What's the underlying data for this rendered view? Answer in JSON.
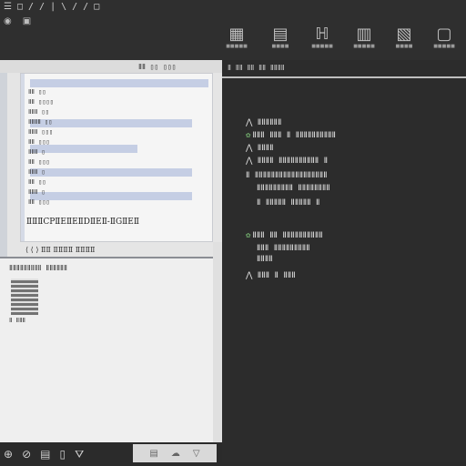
{
  "menu": [
    "☰",
    "□",
    "/",
    "/",
    "|",
    "\\",
    "/",
    "/",
    "□"
  ],
  "toolbar": {
    "left_icons": [
      "◉",
      "▣"
    ],
    "tools": [
      {
        "name": "tool-a",
        "glyph": "▦",
        "label": "■■■■■"
      },
      {
        "name": "tool-b",
        "glyph": "▤",
        "label": "■■■■"
      },
      {
        "name": "tool-c",
        "glyph": "ℍ",
        "label": "■■■■■"
      },
      {
        "name": "tool-d",
        "glyph": "▥",
        "label": "■■■■■"
      },
      {
        "name": "tool-e",
        "glyph": "▧",
        "label": "■■■■"
      },
      {
        "name": "tool-f",
        "glyph": "▢",
        "label": "■■■■■"
      }
    ]
  },
  "left": {
    "header": "ⅡⅡ ▯▯ ▯▯▯",
    "doc_lines": [
      "ⅡⅡ ▯▯",
      "ⅡⅡ ▯▯▯▯",
      "ⅡⅡⅡ ▯▯",
      "ⅡⅡⅡⅡ ▯▯",
      "ⅡⅡⅡ ▯▯▯",
      "ⅡⅡ ▯▯▯",
      "ⅡⅡⅡ ▯",
      "ⅡⅡ ▯▯▯",
      "ⅡⅡⅡ ▯",
      "ⅡⅡ ▯▯",
      "ⅡⅡⅡ ▯",
      "ⅡⅡ ▯▯▯"
    ],
    "doc_caption": "ⅡⅡⅡCPⅡEⅡEⅡDⅡEⅡ-ⅡGⅡEⅡ",
    "below_caption": "⟨ ⟨ ⟩ ⅡⅡ ⅡⅡⅡⅡ ⅡⅡⅡⅡ",
    "lower_title": "ⅡⅡⅡⅡⅡⅡⅡⅡⅡ ⅡⅡⅡⅡⅡⅡ",
    "qr_caption": "Ⅱ ⅡⅡⅡ"
  },
  "right": {
    "tab": "Ⅱ ⅡⅡ ⅡⅡ ⅡⅡ ⅡⅡⅡⅡ",
    "lines": [
      "⋀ ⅡⅡⅡⅡⅡⅡ",
      "ⅡⅡⅡ  ⅡⅡⅡ  Ⅱ  ⅡⅡⅡⅡⅡⅡⅡⅡⅡⅡ",
      "⋀ ⅡⅡⅡⅡ",
      "⋀ ⅡⅡⅡⅡ    ⅡⅡⅡⅡⅡⅡⅡⅡⅡⅡ  Ⅱ",
      "Ⅱ ⅡⅡⅡⅡⅡⅡⅡⅡⅡⅡⅡⅡⅡⅡⅡⅡⅡⅡ",
      "ⅡⅡⅡⅡⅡⅡⅡⅡⅡ   ⅡⅡⅡⅡⅡⅡⅡⅡ",
      "  Ⅱ ⅡⅡⅡⅡⅡ ⅡⅡⅡⅡⅡ  Ⅱ",
      "ⅡⅡⅡ  ⅡⅡ ⅡⅡⅡⅡⅡⅡⅡⅡⅡⅡ",
      "ⅡⅡⅡ   ⅡⅡⅡⅡⅡⅡⅡⅡⅡ",
      "ⅡⅡⅡⅡ",
      "⋀ ⅡⅡⅡ  Ⅱ ⅡⅡⅡ"
    ]
  },
  "bottom": {
    "icons": [
      "⊕",
      "⊘",
      "▤",
      "▯",
      "⛛"
    ],
    "selected_icons": [
      "▤",
      "☁",
      "▽"
    ]
  }
}
